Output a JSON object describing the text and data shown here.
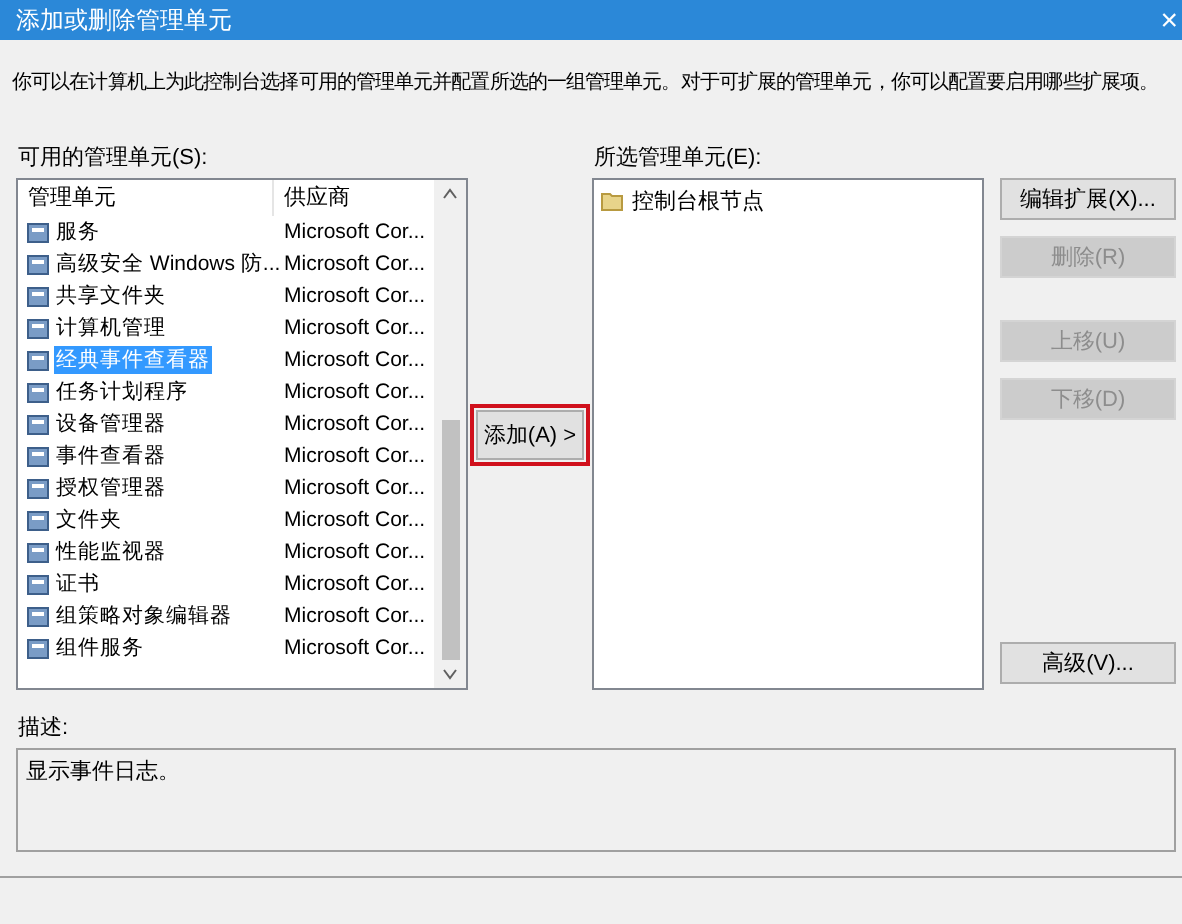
{
  "window": {
    "title": "添加或删除管理单元",
    "close": "×"
  },
  "intro": "你可以在计算机上为此控制台选择可用的管理单元并配置所选的一组管理单元。对于可扩展的管理单元，你可以配置要启用哪些扩展项。",
  "available": {
    "label": "可用的管理单元(S):",
    "columns": [
      "管理单元",
      "供应商"
    ],
    "rows": [
      {
        "name": "服务",
        "vendor": "Microsoft Cor...",
        "selected": false
      },
      {
        "name": "高级安全 Windows 防...",
        "vendor": "Microsoft Cor...",
        "selected": false
      },
      {
        "name": "共享文件夹",
        "vendor": "Microsoft Cor...",
        "selected": false
      },
      {
        "name": "计算机管理",
        "vendor": "Microsoft Cor...",
        "selected": false
      },
      {
        "name": "经典事件查看器",
        "vendor": "Microsoft Cor...",
        "selected": true
      },
      {
        "name": "任务计划程序",
        "vendor": "Microsoft Cor...",
        "selected": false
      },
      {
        "name": "设备管理器",
        "vendor": "Microsoft Cor...",
        "selected": false
      },
      {
        "name": "事件查看器",
        "vendor": "Microsoft Cor...",
        "selected": false
      },
      {
        "name": "授权管理器",
        "vendor": "Microsoft Cor...",
        "selected": false
      },
      {
        "name": "文件夹",
        "vendor": "Microsoft Cor...",
        "selected": false
      },
      {
        "name": "性能监视器",
        "vendor": "Microsoft Cor...",
        "selected": false
      },
      {
        "name": "证书",
        "vendor": "Microsoft Cor...",
        "selected": false
      },
      {
        "name": "组策略对象编辑器",
        "vendor": "Microsoft Cor...",
        "selected": false
      },
      {
        "name": "组件服务",
        "vendor": "Microsoft Cor...",
        "selected": false
      }
    ]
  },
  "add_button": {
    "label": "添加(A) >",
    "highlighted": true
  },
  "selected_snapins": {
    "label": "所选管理单元(E):",
    "items": [
      {
        "name": "控制台根节点",
        "selected": false
      }
    ]
  },
  "buttons": [
    {
      "label": "编辑扩展(X)...",
      "disabled": false
    },
    {
      "label": "删除(R)",
      "disabled": true
    },
    {
      "label": "上移(U)",
      "disabled": true
    },
    {
      "label": "下移(D)",
      "disabled": true
    },
    {
      "label": "高级(V)...",
      "disabled": false
    }
  ],
  "description": {
    "label": "描述:",
    "text": "显示事件日志。"
  }
}
